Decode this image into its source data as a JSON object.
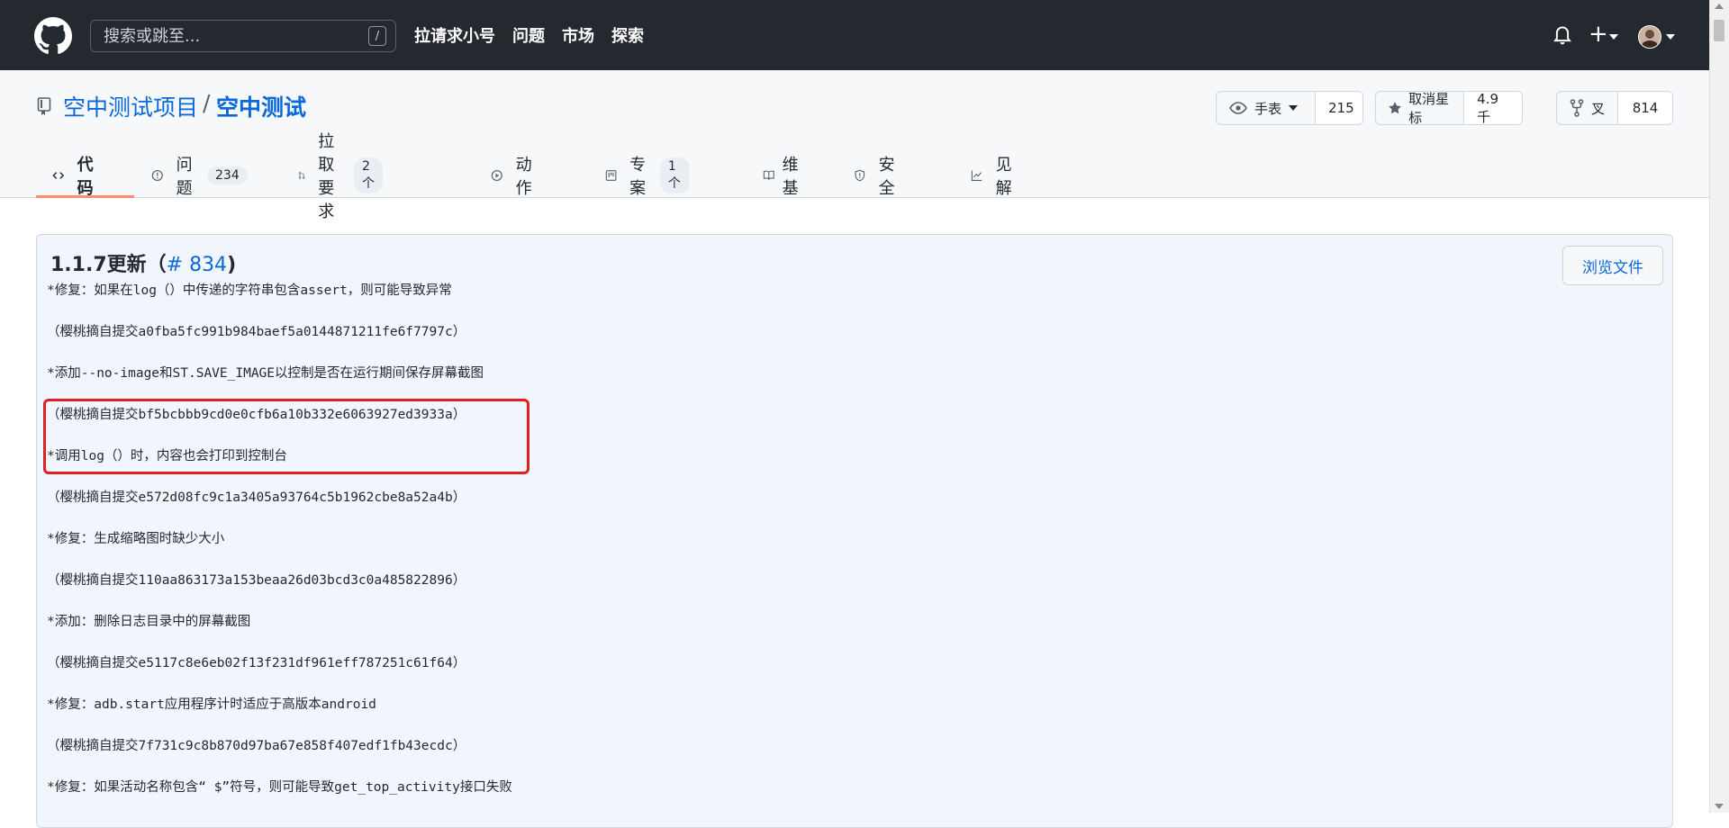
{
  "header": {
    "search_placeholder": "搜索或跳至...",
    "search_shortcut": "/",
    "nav": [
      "拉请求小号",
      "问题",
      "市场",
      "探索"
    ],
    "plus": "+"
  },
  "repo": {
    "owner": "空中测试项目",
    "separator": "/",
    "name": "空中测试",
    "watch_label": "手表",
    "watch_count": "215",
    "star_label": "取消星标",
    "star_count": "4.9千",
    "fork_label": "叉",
    "fork_count": "814"
  },
  "tabs": [
    {
      "label": "代码",
      "icon": "code-icon"
    },
    {
      "label": "问题",
      "icon": "issue-icon",
      "counter": "234"
    },
    {
      "label": "拉取要求",
      "icon": "pull-request-icon",
      "counter": "2个"
    },
    {
      "label": "动作",
      "icon": "play-icon"
    },
    {
      "label": "专案",
      "icon": "project-icon",
      "counter": "1个"
    },
    {
      "label": "维基",
      "icon": "book-icon"
    },
    {
      "label": "安全",
      "icon": "shield-icon"
    },
    {
      "label": "见解",
      "icon": "graph-icon"
    }
  ],
  "release": {
    "title_prefix": "1.1.7更新（",
    "title_link": "# 834",
    "title_suffix": ")",
    "browse_button": "浏览文件",
    "lines": [
      "*修复：如果在log（）中传递的字符串包含assert，则可能导致异常",
      "（樱桃摘自提交a0fba5fc991b984baef5a0144871211fe6f7797c）",
      "*添加--no-image和ST.SAVE_IMAGE以控制是否在运行期间保存屏幕截图",
      "（樱桃摘自提交bf5bcbbb9cd0e0cfb6a10b332e6063927ed3933a）",
      "*调用log（）时，内容也会打印到控制台",
      "（樱桃摘自提交e572d08fc9c1a3405a93764c5b1962cbe8a52a4b）",
      "*修复：生成缩略图时缺少大小",
      "（樱桃摘自提交110aa863173a153beaa26d03bcd3c0a485822896）",
      "*添加：删除日志目录中的屏幕截图",
      "（樱桃摘自提交e5117c8e6eb02f13f231df961eff787251c61f64）",
      "*修复：adb.start应用程序计时适应于高版本android",
      "（樱桃摘自提交7f731c9c8b870d97ba67e858f407edf1fb43ecdc）",
      "*修复：如果活动名称包含“ $”符号，则可能导致get_top_activity接口失败"
    ]
  },
  "colors": {
    "header_bg": "#24292f",
    "link": "#0969da",
    "tab_underline": "#fd8c73",
    "highlight": "#e02020"
  }
}
